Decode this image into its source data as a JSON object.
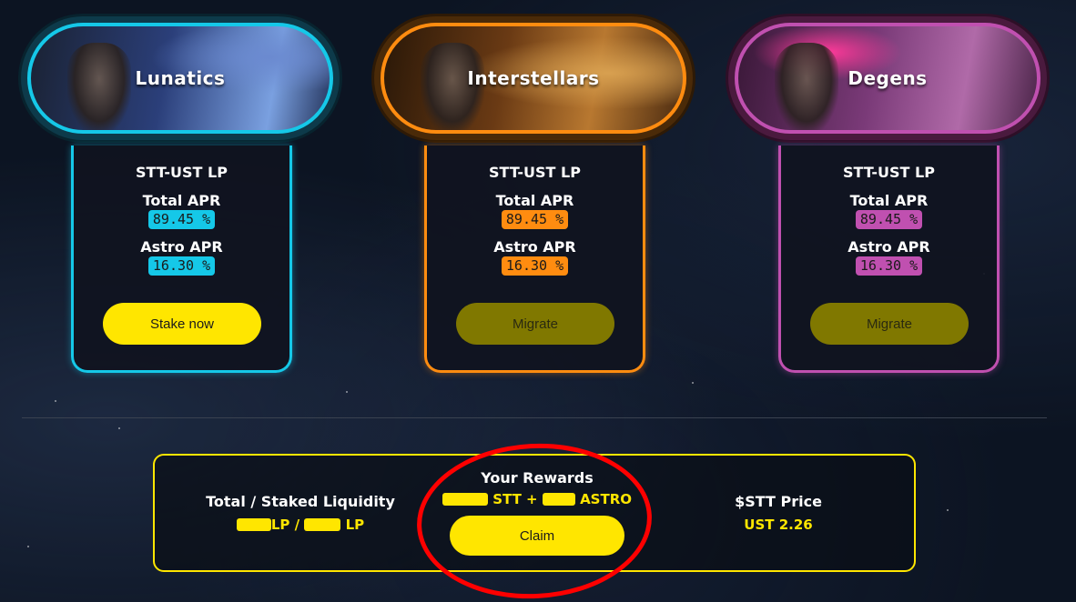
{
  "pools": [
    {
      "title": "Lunatics",
      "lp_name": "STT-UST LP",
      "total_apr_label": "Total APR",
      "total_apr_value": "89.45 %",
      "astro_apr_label": "Astro APR",
      "astro_apr_value": "16.30 %",
      "button_label": "Stake now",
      "accent": "#15c8e8"
    },
    {
      "title": "Interstellars",
      "lp_name": "STT-UST LP",
      "total_apr_label": "Total APR",
      "total_apr_value": "89.45 %",
      "astro_apr_label": "Astro APR",
      "astro_apr_value": "16.30 %",
      "button_label": "Migrate",
      "accent": "#ff8c10"
    },
    {
      "title": "Degens",
      "lp_name": "STT-UST LP",
      "total_apr_label": "Total APR",
      "total_apr_value": "89.45 %",
      "astro_apr_label": "Astro APR",
      "astro_apr_value": "16.30 %",
      "button_label": "Migrate",
      "accent": "#c050b0"
    }
  ],
  "stats": {
    "liquidity_title": "Total / Staked Liquidity",
    "liquidity_unit_total": "LP /",
    "liquidity_unit_staked": "LP",
    "rewards_title": "Your Rewards",
    "rewards_token_stt": "STT +",
    "rewards_token_astro": "ASTRO",
    "claim_label": "Claim",
    "price_title": "$STT Price",
    "price_value": "UST 2.26"
  },
  "colors": {
    "highlight": "#ffe600",
    "annotation": "#ff0000"
  }
}
